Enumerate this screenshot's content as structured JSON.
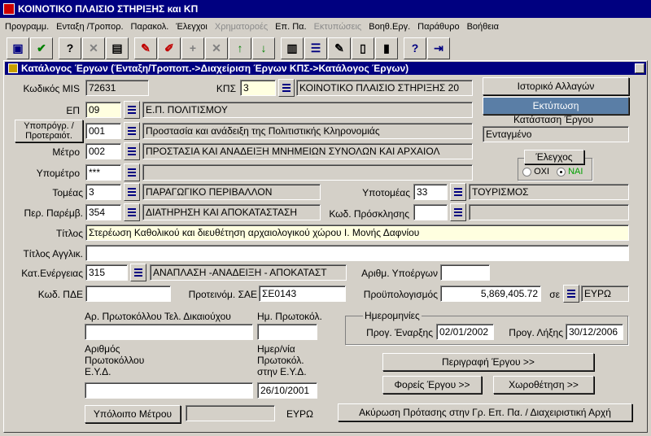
{
  "window": {
    "title": "ΚΟΙΝΟΤΙΚΟ ΠΛΑΙΣΙΟ ΣΤΗΡΙΞΗΣ και ΚΠ"
  },
  "menu": [
    {
      "label": "Προγραμμ.",
      "enabled": true
    },
    {
      "label": "Ενταξη /Τροπορ.",
      "enabled": true
    },
    {
      "label": "Παρακολ.",
      "enabled": true
    },
    {
      "label": "Έλεγχοι",
      "enabled": true
    },
    {
      "label": "Χρηματοροές",
      "enabled": false
    },
    {
      "label": "Επ. Πα.",
      "enabled": true
    },
    {
      "label": "Εκτυπώσεις",
      "enabled": false
    },
    {
      "label": "Βοηθ.Εργ.",
      "enabled": true
    },
    {
      "label": "Παράθυρο",
      "enabled": true
    },
    {
      "label": "Βοήθεια",
      "enabled": true
    }
  ],
  "toolbar": [
    {
      "icon": "save-icon",
      "glyph": "▣",
      "color": "#000080"
    },
    {
      "icon": "check-icon",
      "glyph": "✔",
      "color": "#008000"
    },
    {
      "icon": "query-icon",
      "glyph": "?",
      "color": "#000"
    },
    {
      "icon": "cancel-query-icon",
      "glyph": "✕",
      "color": "#808080"
    },
    {
      "icon": "clone-record-icon",
      "glyph": "▤",
      "color": "#000"
    },
    {
      "icon": "enter-query-icon",
      "glyph": "✎",
      "color": "#c00000"
    },
    {
      "icon": "edit-icon",
      "glyph": "✐",
      "color": "#c00000"
    },
    {
      "icon": "insert-record-icon",
      "glyph": "+",
      "color": "#808080"
    },
    {
      "icon": "delete-record-icon",
      "glyph": "✕",
      "color": "#808080"
    },
    {
      "icon": "arrow-up-icon",
      "glyph": "↑",
      "color": "#008000"
    },
    {
      "icon": "arrow-down-icon",
      "glyph": "↓",
      "color": "#008000"
    },
    {
      "icon": "print-icon",
      "glyph": "▥",
      "color": "#000"
    },
    {
      "icon": "list-icon",
      "glyph": "☰",
      "color": "#000080"
    },
    {
      "icon": "edit-doc-icon",
      "glyph": "✎",
      "color": "#000"
    },
    {
      "icon": "document-icon",
      "glyph": "▯",
      "color": "#000"
    },
    {
      "icon": "clipboard-icon",
      "glyph": "▮",
      "color": "#000"
    },
    {
      "icon": "help-icon",
      "glyph": "?",
      "color": "#000080"
    },
    {
      "icon": "exit-icon",
      "glyph": "⇥",
      "color": "#000080"
    }
  ],
  "document": {
    "title": "Κατάλογος Έργων (Ένταξη/Τροποπ.->Διαχείριση Έργων ΚΠΣ->Κατάλογος Έργων)"
  },
  "form": {
    "mis_label": "Κωδικός MIS",
    "mis_value": "72631",
    "kps_label": "ΚΠΣ",
    "kps_code": "3",
    "kps_name": "ΚΟΙΝΟΤΙΚΟ ΠΛΑΙΣΙΟ ΣΤΗΡΙΞΗΣ 20",
    "ep_label": "ΕΠ",
    "ep_code": "09",
    "ep_name": "Ε.Π. ΠΟΛΙΤΙΣΜΟΥ",
    "subprog_label": "Υποπρόγρ. / Προτεραιότ.",
    "subprog_code": "001",
    "subprog_name": "Προστασία και ανάδειξη της Πολιτιστικής Κληρονομιάς",
    "measure_label": "Μέτρο",
    "measure_code": "002",
    "measure_name": "ΠΡΟΣΤΑΣΙΑ ΚΑΙ ΑΝΑΔΕΙΞΗ ΜΝΗΜΕΙΩΝ ΣΥΝΟΛΩΝ ΚΑΙ ΑΡΧΑΙΟΛ",
    "submeasure_label": "Υπομέτρο",
    "submeasure_code": "***",
    "submeasure_name": "",
    "sector_label": "Τομέας",
    "sector_code": "3",
    "sector_name": "ΠΑΡΑΓΩΓΙΚΟ ΠΕΡΙΒΑΛΛΟΝ",
    "subsector_label": "Υποτομέας",
    "subsector_code": "33",
    "subsector_name": "ΤΟΥΡΙΣΜΟΣ",
    "intervention_label": "Περ. Παρέμβ.",
    "intervention_code": "354",
    "intervention_name": "ΔΙΑΤΗΡΗΣΗ ΚΑΙ ΑΠΟΚΑΤΑΣΤΑΣΗ",
    "call_label": "Κωδ. Πρόσκλησης",
    "call_code": "",
    "call_name": "",
    "title_label": "Τίτλος",
    "title_value": "Στερέωση Καθολικού  και διευθέτηση αρχαιολογικού χώρου Ι. Μονής Δαφνίου",
    "title_en_label": "Τίτλος Αγγλικ.",
    "title_en_value": "",
    "activity_label": "Κατ.Ενέργειας",
    "activity_code": "315",
    "activity_name": "ΑΝΑΠΛΑΣΗ -ΑΝΑΔΕΙΞΗ - ΑΠΟΚΑΤΑΣΤ",
    "subprojects_label": "Αριθμ. Υποέργων",
    "subprojects_value": "",
    "pde_label": "Κωδ. ΠΔΕ",
    "pde_value": "",
    "sae_label": "Προτεινόμ. ΣΑΕ",
    "sae_value": "ΣΕ0143",
    "budget_label": "Προϋπολογισμός",
    "budget_value": "5,869,405.72",
    "currency_prefix": "σε",
    "currency_value": "ΕΥΡΩ",
    "protocol_ben_label": "Αρ. Πρωτοκόλλου Τελ. Δικαιούχου",
    "protocol_ben_value": "",
    "protocol_date_label": "Ημ. Πρωτοκόλ.",
    "protocol_date_value": "",
    "protocol_eyd_label_1": "Αριθμός",
    "protocol_eyd_label_2": "Πρωτοκόλλου",
    "protocol_eyd_label_3": "Ε.Υ.Δ.",
    "protocol_eyd_value": "",
    "protocol_eyd_date_label_1": "Ημερ/νία",
    "protocol_eyd_date_label_2": "Πρωτοκόλ.",
    "protocol_eyd_date_label_3": "στην Ε.Υ.Δ.",
    "protocol_eyd_date_value": "26/10/2001",
    "dates_frame_label": "Ημερομηνίες",
    "start_label": "Προγ. Έναρξης",
    "start_value": "02/01/2002",
    "end_label": "Προγ. Λήξης",
    "end_value": "30/12/2006",
    "remaining_button": "Υπόλοιπο Μέτρου",
    "remaining_value": "",
    "remaining_currency": "ΕΥΡΩ",
    "history_button": "Ιστορικό Αλλαγών",
    "print_button": "Εκτύπωση",
    "status_label": "Κατάσταση Έργου",
    "status_value": "Ενταγμένο",
    "checked_label": "Έλεγχος",
    "checked_no": "ΟΧΙ",
    "checked_yes": "ΝΑΙ",
    "checked_selected": "yes",
    "description_button": "Περιγραφή Έργου >>",
    "bodies_button": "Φορείς Έργου >>",
    "location_button": "Χωροθέτηση >>",
    "cancel_button": "Ακύρωση Πρότασης στην Γρ. Επ. Πα. / Διαχειριστική Αρχή"
  }
}
